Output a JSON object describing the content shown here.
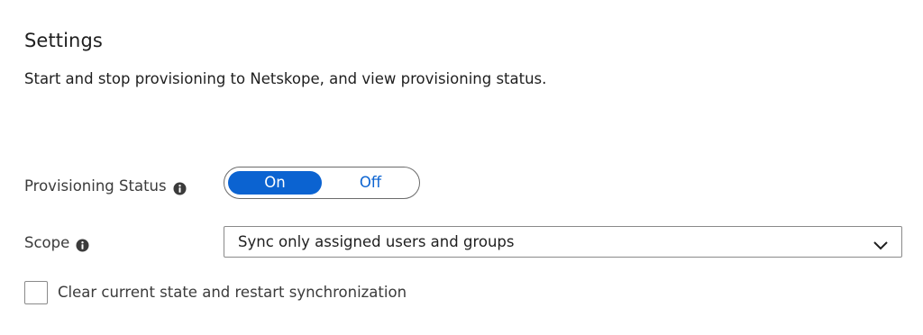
{
  "settings": {
    "title": "Settings",
    "description": "Start and stop provisioning to Netskope, and view provisioning status."
  },
  "provisioning_status": {
    "label": "Provisioning Status",
    "info_icon": "info-icon",
    "options": [
      "On",
      "Off"
    ],
    "selected": "On"
  },
  "scope": {
    "label": "Scope",
    "info_icon": "info-icon",
    "selected": "Sync only assigned users and groups",
    "chevron_icon": "chevron-down-icon"
  },
  "restart": {
    "label": "Clear current state and restart synchronization",
    "checked": false
  },
  "colors": {
    "accent": "#0b63d1",
    "text": "#1f1f1f",
    "border": "#8a8a8a"
  }
}
